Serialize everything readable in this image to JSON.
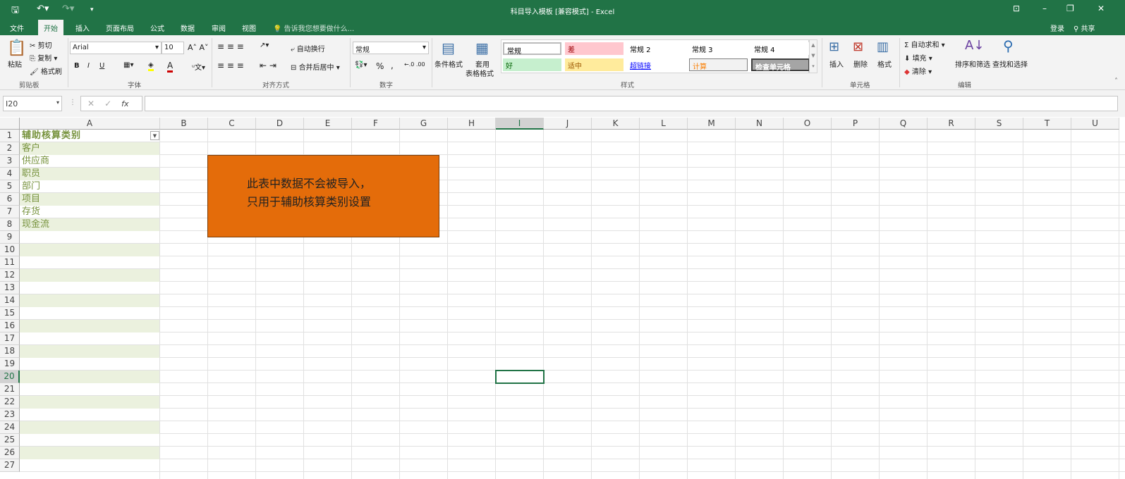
{
  "window": {
    "title": "科目导入模板  [兼容模式] - Excel",
    "login": "登录",
    "share": "共享"
  },
  "tabs": [
    "文件",
    "开始",
    "插入",
    "页面布局",
    "公式",
    "数据",
    "审阅",
    "视图"
  ],
  "tell_me": "告诉我您想要做什么...",
  "ribbon": {
    "clipboard": {
      "paste": "粘贴",
      "cut": "剪切",
      "copy": "复制",
      "format_painter": "格式刷",
      "label": "剪贴板"
    },
    "font": {
      "name": "Arial",
      "size": "10",
      "bold": "B",
      "italic": "I",
      "underline": "U",
      "label": "字体"
    },
    "alignment": {
      "wrap": "自动换行",
      "merge": "合并后居中",
      "label": "对齐方式"
    },
    "number": {
      "format": "常规",
      "percent": "%",
      "comma": ",",
      "label": "数字"
    },
    "styles": {
      "conditional": "条件格式",
      "table": "套用",
      "table2": "表格格式",
      "label": "样式",
      "items": [
        {
          "label": "常规",
          "bg": "#ffffff",
          "fg": "#000000"
        },
        {
          "label": "差",
          "bg": "#FFC7CE",
          "fg": "#9C0006"
        },
        {
          "label": "常规 2",
          "bg": "#ffffff",
          "fg": "#000000"
        },
        {
          "label": "常规 3",
          "bg": "#ffffff",
          "fg": "#000000"
        },
        {
          "label": "常规 4",
          "bg": "#ffffff",
          "fg": "#000000"
        },
        {
          "label": "好",
          "bg": "#C6EFCE",
          "fg": "#006100"
        },
        {
          "label": "适中",
          "bg": "#FFEB9C",
          "fg": "#9C5700"
        },
        {
          "label": "超链接",
          "bg": "#ffffff",
          "fg": "#0000FF"
        },
        {
          "label": "计算",
          "bg": "#F2F2F2",
          "fg": "#FA7D00"
        },
        {
          "label": "检查单元格",
          "bg": "#A5A5A5",
          "fg": "#ffffff"
        }
      ]
    },
    "cells": {
      "insert": "插入",
      "delete": "删除",
      "format": "格式",
      "label": "单元格"
    },
    "editing": {
      "autosum": "自动求和",
      "fill": "填充",
      "clear": "清除",
      "sort": "排序和筛选",
      "find": "查找和选择",
      "label": "编辑"
    }
  },
  "formula_bar": {
    "name_box": "I20",
    "fx": "fx",
    "value": ""
  },
  "columns": [
    "A",
    "B",
    "C",
    "D",
    "E",
    "F",
    "G",
    "H",
    "I",
    "J",
    "K",
    "L",
    "M",
    "N",
    "O",
    "P",
    "Q",
    "R",
    "S",
    "T",
    "U"
  ],
  "rows": 27,
  "column_a": [
    "辅助核算类别",
    "客户",
    "供应商",
    "职员",
    "部门",
    "项目",
    "存货",
    "现金流"
  ],
  "selected_cell": "I20",
  "shape_text": [
    "此表中数据不会被导入，",
    "只用于辅助核算类别设置"
  ],
  "colors": {
    "accent": "#217346",
    "shape": "#E46C0A",
    "band": "#EBF1DE",
    "text": "#76923C"
  }
}
